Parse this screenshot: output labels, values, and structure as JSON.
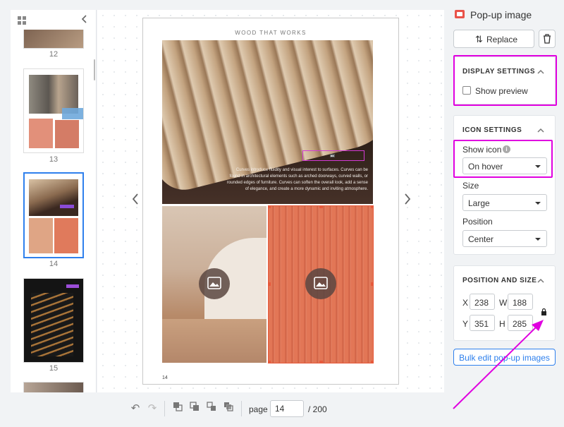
{
  "sidebar": {
    "thumbnails": [
      {
        "page": "12"
      },
      {
        "page": "13"
      },
      {
        "page": "14",
        "active": true
      },
      {
        "page": "15"
      }
    ]
  },
  "canvas": {
    "page_heading": "WOOD THAT WORKS",
    "hero_text": "Curves introduce fluidity and visual interest to surfaces. Curves can be found in architectural elements such as arched doorways, curved walls, or rounded edges of furniture. Curves can soften the overall look, add a sense of elegance, and create a more dynamic and inviting atmosphere.",
    "page_number": "14"
  },
  "toolbar": {
    "page_label": "page",
    "current_page": "14",
    "total_pages": "/ 200"
  },
  "panel": {
    "title": "Pop-up image",
    "replace_label": "Replace",
    "display_settings": {
      "title": "DISPLAY SETTINGS",
      "show_preview_label": "Show preview",
      "show_preview_checked": false
    },
    "icon_settings": {
      "title": "ICON SETTINGS",
      "show_icon_label": "Show icon",
      "show_icon_value": "On hover",
      "size_label": "Size",
      "size_value": "Large",
      "position_label": "Position",
      "position_value": "Center"
    },
    "position_size": {
      "title": "POSITION AND SIZE",
      "x_label": "X",
      "x_value": "238",
      "w_label": "W",
      "w_value": "188",
      "y_label": "Y",
      "y_value": "351",
      "h_label": "H",
      "h_value": "285"
    },
    "bulk_edit_label": "Bulk edit pop-up images"
  },
  "colors": {
    "annotation_magenta": "#e000e0",
    "accent_blue": "#2f80ed",
    "selection_orange": "#e75a3c"
  },
  "icons": [
    "grid-icon",
    "collapse-sidebar-icon",
    "prev-page-icon",
    "next-page-icon",
    "popup-image-icon",
    "undo-icon",
    "redo-icon",
    "bring-front-icon",
    "send-back-icon",
    "bring-forward-icon",
    "send-backward-icon",
    "swap-icon",
    "trash-icon",
    "info-icon",
    "lock-icon",
    "chevron-up-icon"
  ]
}
